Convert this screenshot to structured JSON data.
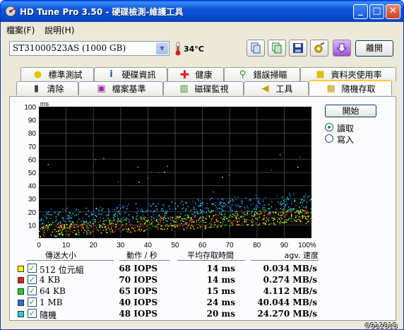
{
  "window": {
    "title": "HD Tune Pro 3.50 - 硬碟檢測-維護工具",
    "minimize": "_",
    "maximize": "□",
    "close": "✕"
  },
  "menu": {
    "file": "檔案(F)",
    "help": "說明(H)"
  },
  "toolbar": {
    "drive": "ST31000523AS (1000 GB)",
    "temperature": "34°C",
    "exit_label": "離開",
    "icons": [
      "copy-text-icon",
      "copy-screenshot-icon",
      "save-icon",
      "options-icon",
      "download-icon"
    ]
  },
  "tabs_row1": [
    "標準測試",
    "硬碟資訊",
    "健康",
    "錯誤掃瞄",
    "資料夾使用率"
  ],
  "tabs_row2": [
    "清除",
    "檔案基準",
    "磁碟監視",
    "工具",
    "隨機存取"
  ],
  "active_tab": "隨機存取",
  "controls": {
    "start": "開始",
    "read": "讀取",
    "write": "寫入",
    "selected": "read"
  },
  "chart_data": {
    "type": "scatter",
    "ylabel": "ms",
    "ylim": [
      0,
      100
    ],
    "yticks": [
      "10",
      "20",
      "30",
      "40",
      "50",
      "60",
      "70",
      "80",
      "90",
      "100"
    ],
    "xlim": [
      0,
      100
    ],
    "xticks": [
      "0",
      "10",
      "20",
      "30",
      "40",
      "50",
      "60",
      "70",
      "80",
      "90",
      "100%"
    ],
    "grid": true,
    "series": [
      {
        "name": "512 位元組",
        "color": "#e8e800",
        "base": [
          6,
          17
        ],
        "spread": 5
      },
      {
        "name": "4 KB",
        "color": "#e02020",
        "base": [
          6,
          18
        ],
        "spread": 5
      },
      {
        "name": "64 KB",
        "color": "#22cc22",
        "base": [
          7,
          19
        ],
        "spread": 6
      },
      {
        "name": "1 MB",
        "color": "#2a6fd8",
        "base": [
          16,
          30
        ],
        "spread": 6
      },
      {
        "name": "隨機",
        "color": "#22d0d8",
        "base": [
          14,
          26
        ],
        "spread": 7
      }
    ]
  },
  "table": {
    "headers": [
      "傳送大小",
      "動作 / 秒",
      "平均存取時間",
      "agv. 速度"
    ],
    "rows": [
      {
        "label": "512 位元組",
        "color": "#ffff00",
        "checked": true,
        "iops": "68 IOPS",
        "access": "14 ms",
        "speed": "0.034 MB/s"
      },
      {
        "label": "4 KB",
        "color": "#e02020",
        "checked": true,
        "iops": "70 IOPS",
        "access": "14 ms",
        "speed": "0.274 MB/s"
      },
      {
        "label": "64 KB",
        "color": "#22cc22",
        "checked": true,
        "iops": "65 IOPS",
        "access": "15 ms",
        "speed": "4.112 MB/s"
      },
      {
        "label": "1 MB",
        "color": "#2a6fd8",
        "checked": true,
        "iops": "40 IOPS",
        "access": "24 ms",
        "speed": "40.044 MB/s"
      },
      {
        "label": "隨機",
        "color": "#22d0d8",
        "checked": true,
        "iops": "48 IOPS",
        "access": "20 ms",
        "speed": "24.270 MB/s"
      }
    ]
  },
  "watermark": "#912818"
}
